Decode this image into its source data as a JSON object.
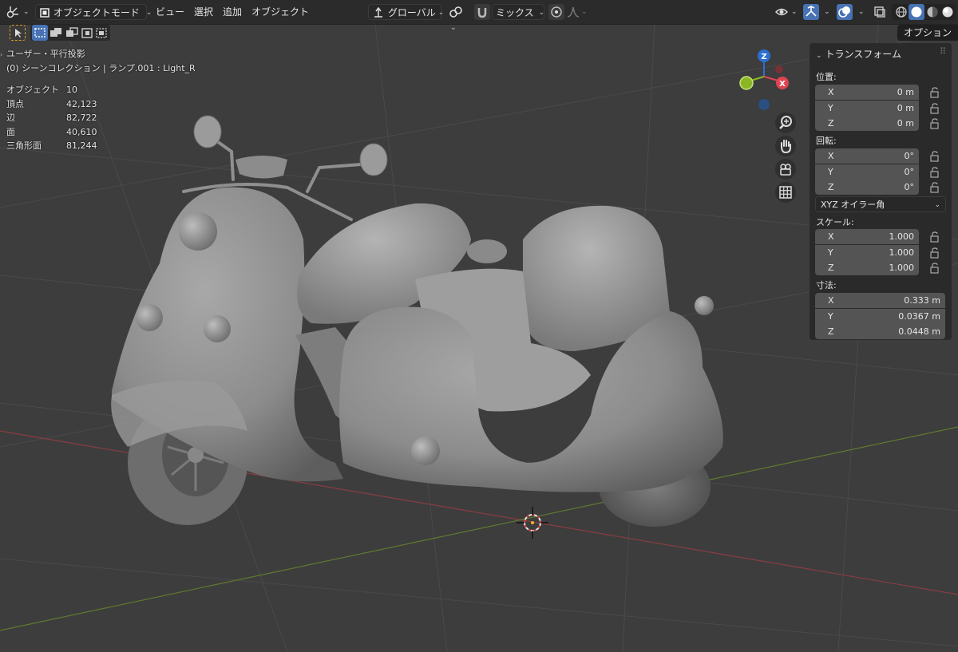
{
  "header": {
    "mode_label": "オブジェクトモード",
    "menus": [
      "ビュー",
      "選択",
      "追加",
      "オブジェクト"
    ],
    "transform_orientation": "グローバル",
    "pivot_label": "ミックス",
    "options_tab": "オプション"
  },
  "viewport": {
    "view_name": "ユーザー・平行投影",
    "collection_info": "(0) シーンコレクション | ランプ.001 : Light_R",
    "stats": [
      {
        "label": "オブジェクト",
        "value": "10"
      },
      {
        "label": "頂点",
        "value": "42,123"
      },
      {
        "label": "辺",
        "value": "82,722"
      },
      {
        "label": "面",
        "value": "40,610"
      },
      {
        "label": "三角形面",
        "value": "81,244"
      }
    ]
  },
  "gizmo": {
    "z_label": "Z",
    "x_label": "X",
    "colors": {
      "x": "#e04451",
      "y": "#8ab626",
      "z": "#2d6fd0"
    }
  },
  "npanel": {
    "title": "トランスフォーム",
    "location": {
      "label": "位置:",
      "x": "0 m",
      "y": "0 m",
      "z": "0 m"
    },
    "rotation": {
      "label": "回転:",
      "x": "0°",
      "y": "0°",
      "z": "0°"
    },
    "rotation_mode": "XYZ オイラー角",
    "scale": {
      "label": "スケール:",
      "x": "1.000",
      "y": "1.000",
      "z": "1.000"
    },
    "dimensions": {
      "label": "寸法:",
      "x": "0.333 m",
      "y": "0.0367 m",
      "z": "0.0448 m"
    },
    "axis_labels": {
      "x": "X",
      "y": "Y",
      "z": "Z"
    }
  },
  "colors": {
    "background": "#3d3d3d",
    "header": "#2b2b2b",
    "accent": "#4772b3"
  }
}
